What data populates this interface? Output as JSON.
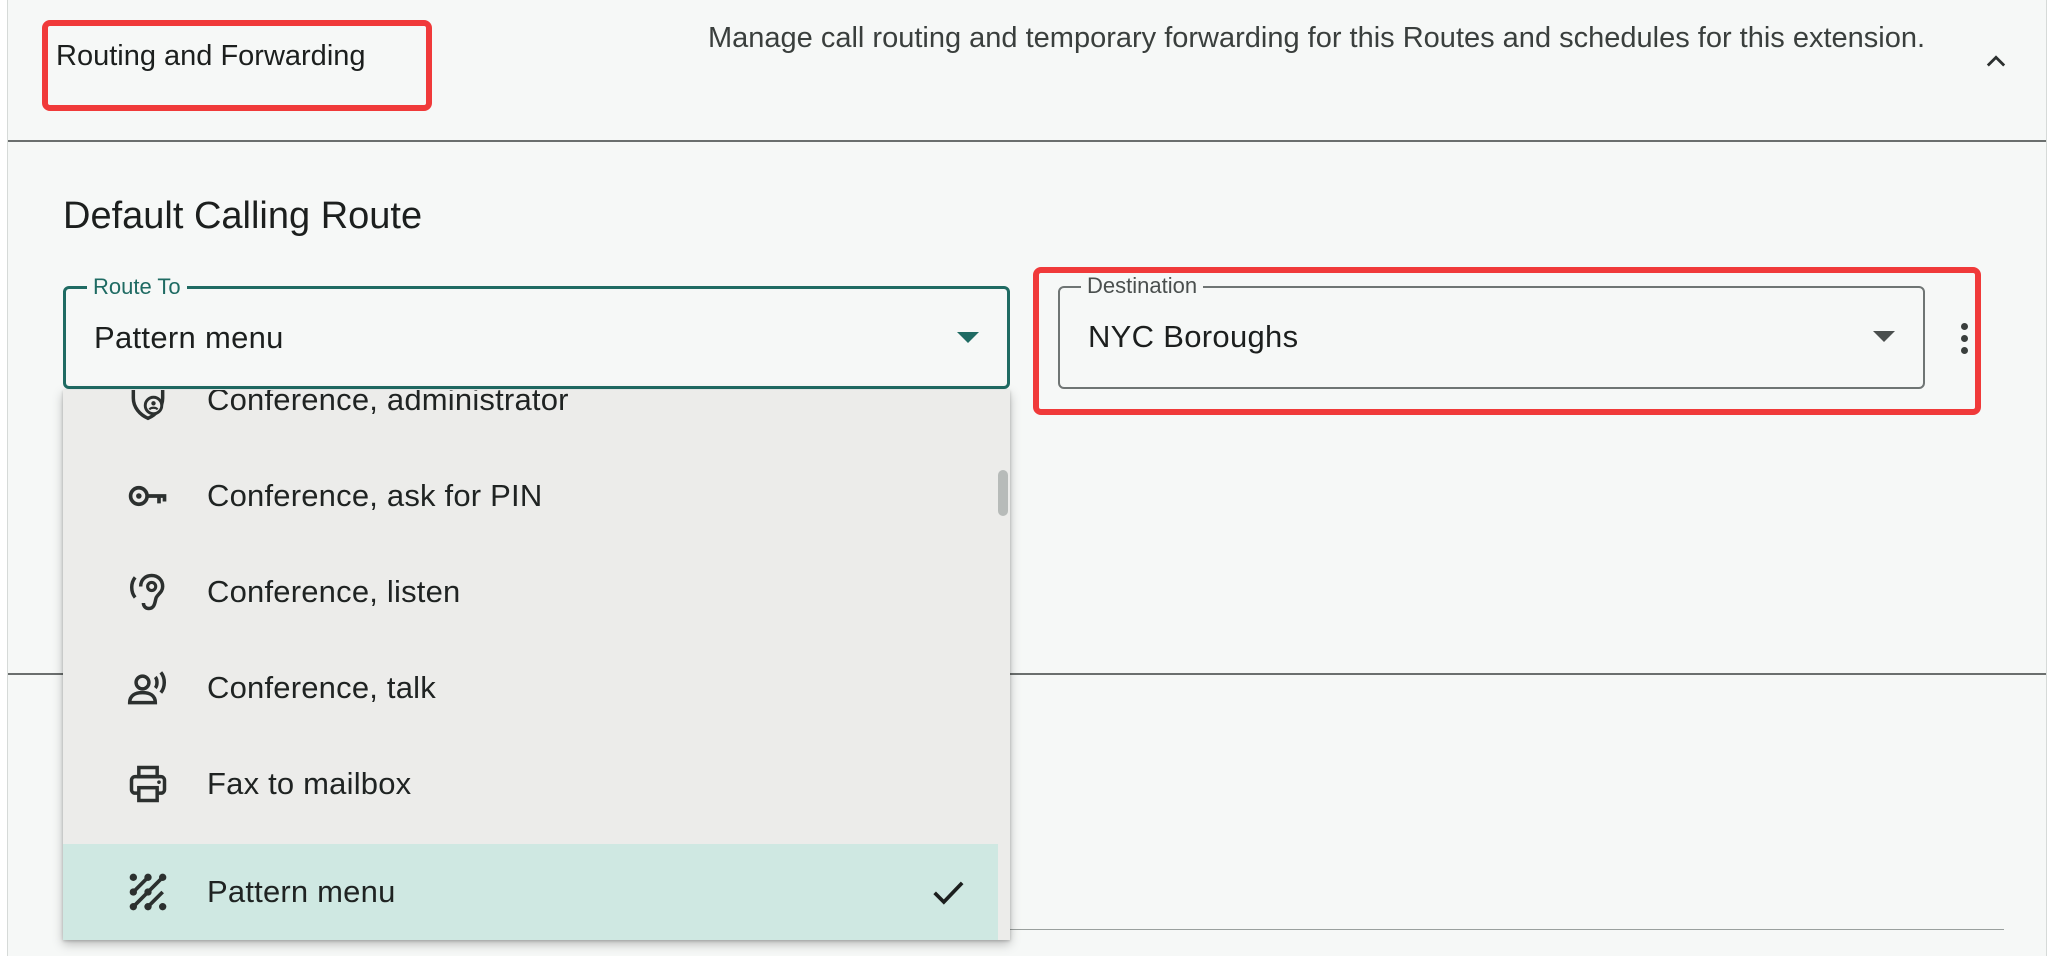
{
  "header": {
    "title": "Routing and Forwarding",
    "description": "Manage call routing and temporary forwarding for this Routes and schedules for this extension.",
    "collapse_icon": "chevron-up-icon"
  },
  "section": {
    "title": "Default Calling Route"
  },
  "route_to": {
    "label": "Route To",
    "value": "Pattern menu"
  },
  "destination": {
    "label": "Destination",
    "value": "NYC Boroughs"
  },
  "menu": {
    "items": [
      {
        "label": "Conference, administrator",
        "icon": "shield-person-icon"
      },
      {
        "label": "Conference, ask for PIN",
        "icon": "key-icon"
      },
      {
        "label": "Conference, listen",
        "icon": "hearing-icon"
      },
      {
        "label": "Conference, talk",
        "icon": "record-voice-icon"
      },
      {
        "label": "Fax to mailbox",
        "icon": "printer-icon"
      },
      {
        "label": "Pattern menu",
        "icon": "pattern-icon",
        "selected": true
      }
    ]
  },
  "colors": {
    "accent": "#1f6b63",
    "highlight_box": "#f03a3a",
    "selected_bg": "#cfe8e2"
  }
}
